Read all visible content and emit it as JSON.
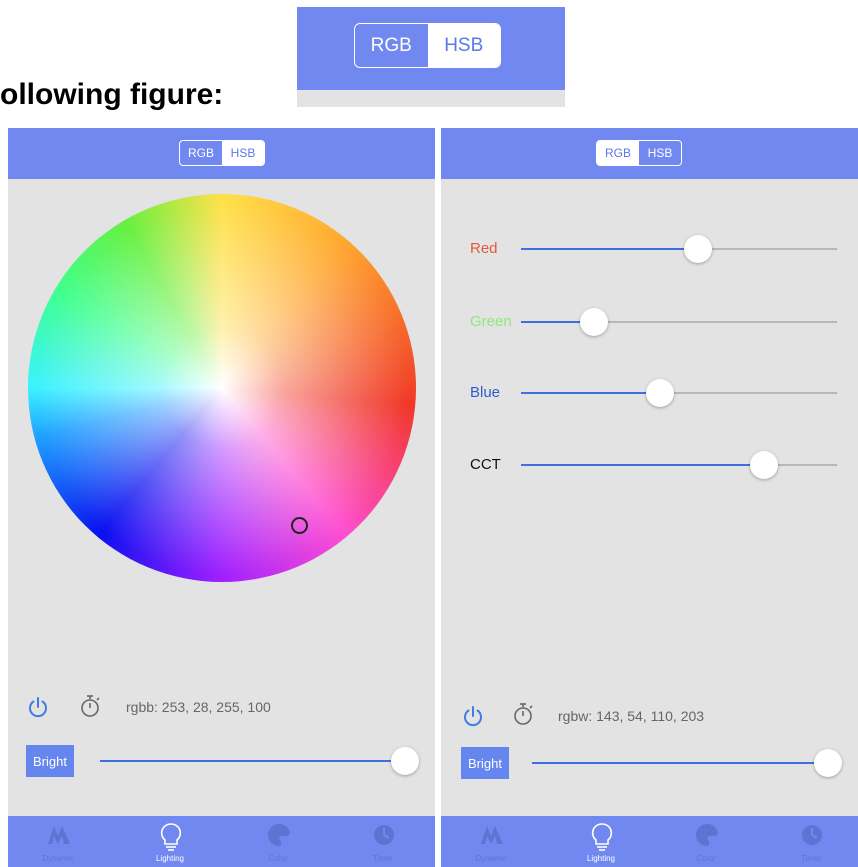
{
  "heading": "ollowing figure:",
  "mode_toggle": {
    "rgb_label": "RGB",
    "hsb_label": "HSB"
  },
  "left_screen": {
    "status_text": "rgbb: 253, 28, 255, 100",
    "bright_label": "Bright",
    "brightness_fraction": 0.97
  },
  "right_screen": {
    "sliders": [
      {
        "label": "Red",
        "color": "#e45a3c",
        "value_fraction": 0.56
      },
      {
        "label": "Green",
        "color": "#8ee87a",
        "value_fraction": 0.23
      },
      {
        "label": "Blue",
        "color": "#2f5bcf",
        "value_fraction": 0.44
      },
      {
        "label": "CCT",
        "color": "#111111",
        "value_fraction": 0.77
      }
    ],
    "status_text": "rgbw: 143, 54, 110, 203",
    "bright_label": "Bright",
    "brightness_fraction": 0.97
  },
  "tabs": [
    {
      "label": "Dynamic",
      "icon": "dynamic-icon",
      "active": false
    },
    {
      "label": "Lighting",
      "icon": "bulb-icon",
      "active": true
    },
    {
      "label": "Color",
      "icon": "palette-icon",
      "active": false
    },
    {
      "label": "Timer",
      "icon": "timer-icon",
      "active": false
    }
  ],
  "colors": {
    "header": "#7088f0",
    "accent": "#3f6ee0",
    "background": "#e3e3e3"
  }
}
